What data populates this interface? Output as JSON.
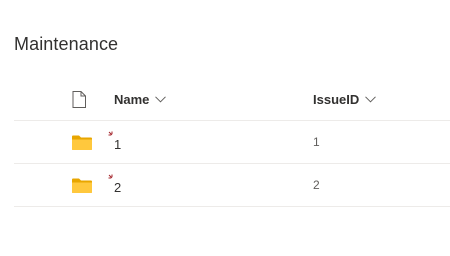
{
  "page": {
    "title": "Maintenance"
  },
  "list": {
    "columns": [
      {
        "key": "type",
        "label": "",
        "icon": "file-icon"
      },
      {
        "key": "name",
        "label": "Name",
        "icon": "chevron-down-icon"
      },
      {
        "key": "issue_id",
        "label": "IssueID",
        "icon": "chevron-down-icon"
      }
    ],
    "rows": [
      {
        "icon": "folder-icon",
        "name": "1",
        "issue_id": "1",
        "new_indicator": "new-item-icon"
      },
      {
        "icon": "folder-icon",
        "name": "2",
        "issue_id": "2",
        "new_indicator": "new-item-icon"
      }
    ]
  },
  "colors": {
    "folder": "#ffb900",
    "folder_dark": "#e8a600",
    "new_indicator": "#a4262c",
    "divider": "#edebe9",
    "text": "#323130",
    "muted_text": "#605e5c"
  }
}
